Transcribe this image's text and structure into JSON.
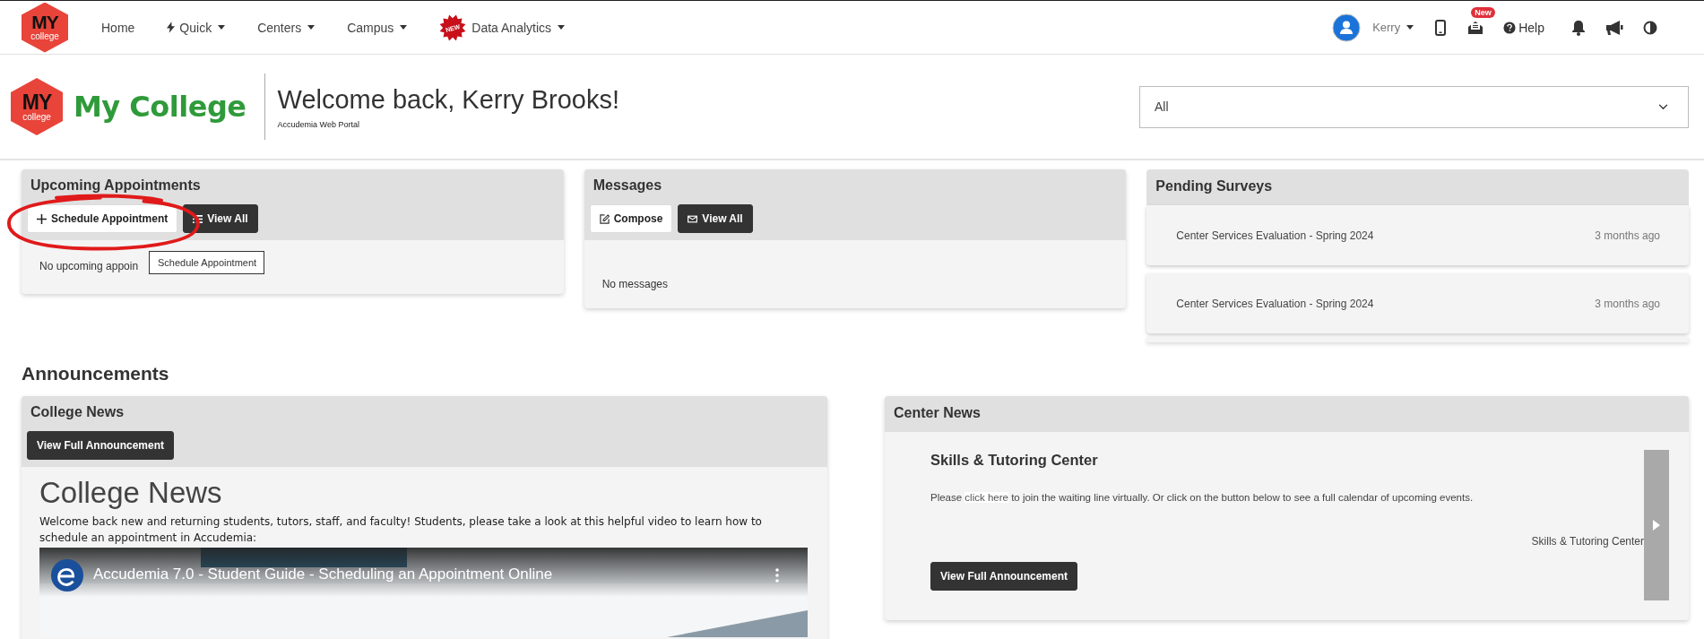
{
  "nav": {
    "logo_text": [
      "MY",
      "college"
    ],
    "items": [
      {
        "label": "Home",
        "kind": "link"
      },
      {
        "label": "Quick",
        "kind": "quick-menu"
      },
      {
        "label": "Centers",
        "kind": "menu"
      },
      {
        "label": "Campus",
        "kind": "menu"
      },
      {
        "label": "Data Analytics",
        "kind": "new-menu",
        "badge": "NEW"
      }
    ],
    "user": {
      "name": "Kerry"
    },
    "mail_badge": "New",
    "help": "Help"
  },
  "header": {
    "logo_text": [
      "MY",
      "college"
    ],
    "brand": "My College",
    "title": "Welcome back, Kerry Brooks!",
    "subtitle": "Accudemia Web Portal",
    "filter": {
      "value": "All"
    }
  },
  "appointments": {
    "title": "Upcoming Appointments",
    "buttons": [
      {
        "label": "Schedule Appointment",
        "kind": "plus"
      },
      {
        "label": "View All",
        "kind": "list"
      }
    ],
    "annotation": {
      "kind": "ellipse"
    },
    "empty": "No upcoming appoin",
    "tooltip": "Schedule Appointment"
  },
  "messages": {
    "title": "Messages",
    "buttons": [
      {
        "label": "Compose",
        "kind": "edit"
      },
      {
        "label": "View All",
        "kind": "envelope"
      }
    ],
    "empty": "No messages"
  },
  "surveys": {
    "title": "Pending Surveys",
    "items": [
      {
        "title": "Center Services Evaluation - Spring 2024",
        "time": "3 months ago"
      },
      {
        "title": "Center Services Evaluation - Spring 2024",
        "time": "3 months ago"
      }
    ]
  },
  "announcements": {
    "title": "Announcements",
    "college_news": {
      "title": "College News",
      "button": "View Full Announcement",
      "heading": "College News",
      "paragraph": "Welcome back new and returning students, tutors, staff, and faculty!  Students, please take a look at this helpful video to learn how to schedule an appointment in Accudemia:",
      "video_title": "Accudemia 7.0 - Student Guide - Scheduling an Appointment Online"
    },
    "center_news": {
      "title": "Center News",
      "heading": "Skills & Tutoring Center",
      "text_before": "Please ",
      "link": "click here",
      "text_after": " to join the waiting line virtually.  Or click on the button below to see a full calendar of upcoming events.",
      "signature": "Skills & Tutoring Center",
      "button": "View Full Announcement"
    }
  }
}
